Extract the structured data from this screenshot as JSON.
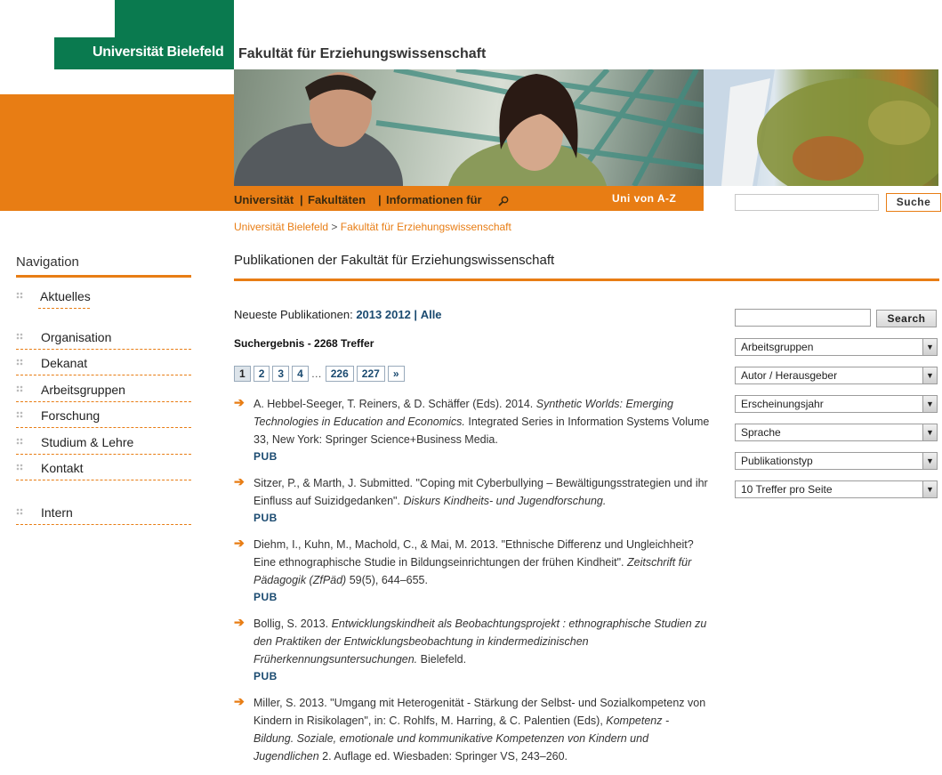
{
  "header": {
    "university_logo": "Universität Bielefeld",
    "faculty_title": "Fakultät für Erziehungswissenschaft",
    "topnav": [
      "Universität",
      "Fakultäten",
      "Informationen für"
    ],
    "az_link": "Uni von A-Z",
    "search_button": "Suche",
    "brand_orange": "#e87d14",
    "brand_green": "#0a7a4f"
  },
  "breadcrumb": {
    "home": "Universität Bielefeld",
    "separator": ">",
    "current": "Fakultät für Erziehungswissenschaft"
  },
  "navigation": {
    "title": "Navigation",
    "items": [
      "Aktuelles",
      "Organisation",
      "Dekanat",
      "Arbeitsgruppen",
      "Forschung",
      "Studium & Lehre",
      "Kontakt",
      "Intern"
    ]
  },
  "main": {
    "heading": "Publikationen der Fakultät für Erziehungswissenschaft",
    "newest_label": "Neueste Publikationen:",
    "newest_links": [
      "2013",
      "2012",
      "Alle"
    ],
    "newest_sep": "|",
    "result_count": "Suchergebnis - 2268 Treffer",
    "pager": [
      "1",
      "2",
      "3",
      "4",
      "…",
      "226",
      "227",
      "»"
    ],
    "publications": [
      {
        "pre": "A. Hebbel-Seeger, T. Reiners, & D. Schäffer (Eds). 2014. ",
        "italic": "Synthetic Worlds: Emerging Technologies in Education and Economics.",
        "post": " Integrated Series in Information Systems Volume 33, New York: Springer Science+Business Media.",
        "link": "PUB"
      },
      {
        "pre": "Sitzer, P., & Marth, J. Submitted. \"Coping mit Cyberbullying – Bewältigungsstrategien und ihr Einfluss auf Suizidgedanken\". ",
        "italic": "Diskurs Kindheits- und Jugendforschung.",
        "post": "",
        "link": "PUB"
      },
      {
        "pre": "Diehm, I., Kuhn, M., Machold, C., & Mai, M. 2013. \"Ethnische Differenz und Ungleichheit? Eine ethnographische Studie in Bildungseinrichtungen der frühen Kindheit\". ",
        "italic": "Zeitschrift für Pädagogik (ZfPäd)",
        "post": " 59(5), 644–655.",
        "link": "PUB"
      },
      {
        "pre": "Bollig, S. 2013. ",
        "italic": "Entwicklungskindheit als Beobachtungsprojekt : ethnographische Studien zu den Praktiken der Entwicklungsbeobachtung in kindermedizinischen Früherkennungsuntersuchungen.",
        "post": " Bielefeld.",
        "link": "PUB"
      },
      {
        "pre": "Miller, S. 2013. \"Umgang mit Heterogenität - Stärkung der Selbst- und Sozialkompetenz von Kindern in Risikolagen\", in: C. Rohlfs, M. Harring, & C. Palentien (Eds), ",
        "italic": "Kompetenz - Bildung. Soziale, emotionale und kommunikative Kompetenzen von Kindern und Jugendlichen",
        "post": " 2. Auflage ed. Wiesbaden: Springer VS, 243–260.",
        "link": ""
      }
    ]
  },
  "filters": {
    "search_button": "Search",
    "selects": [
      "Arbeitsgruppen",
      "Autor / Herausgeber",
      "Erscheinungsjahr",
      "Sprache",
      "Publikationstyp",
      "10 Treffer pro Seite"
    ]
  }
}
